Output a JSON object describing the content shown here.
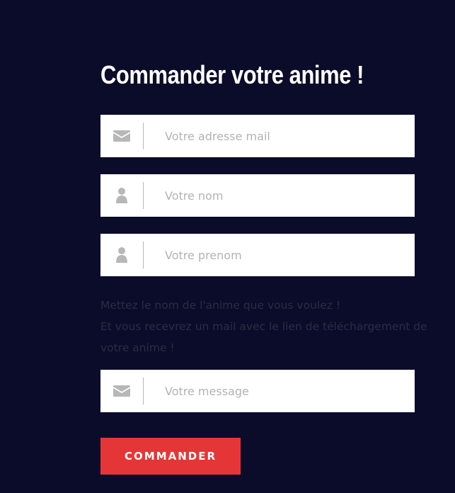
{
  "form": {
    "title": "Commander votre anime !",
    "fields": [
      {
        "placeholder": "Votre adresse mail",
        "icon": "envelope-icon"
      },
      {
        "placeholder": "Votre nom",
        "icon": "user-icon"
      },
      {
        "placeholder": "Votre prenom",
        "icon": "user-icon"
      },
      {
        "placeholder": "Votre message",
        "icon": "envelope-icon"
      }
    ],
    "help_line1": "Mettez le nom de l'anime que vous voulez !",
    "help_line2": "Et vous recevrez un mail avec le lien de téléchargement de votre anime !",
    "submit_label": "COMMANDER"
  },
  "colors": {
    "background": "#0b0c2a",
    "accent": "#e53637",
    "icon": "#b7b7b7",
    "muted_text": "#2b2c44"
  }
}
